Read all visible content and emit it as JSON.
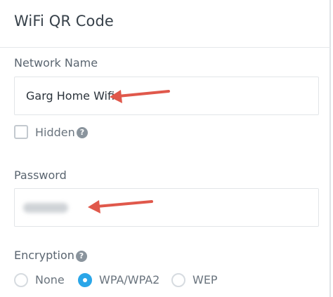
{
  "title": "WiFi QR Code",
  "network": {
    "label": "Network Name",
    "value": "Garg Home Wifi",
    "hidden_label": "Hidden",
    "hidden_checked": false,
    "help_glyph": "?"
  },
  "password": {
    "label": "Password",
    "value_obscured": true
  },
  "encryption": {
    "label": "Encryption",
    "help_glyph": "?",
    "options": [
      "None",
      "WPA/WPA2",
      "WEP"
    ],
    "selected": "WPA/WPA2"
  },
  "colors": {
    "accent": "#2aa6e8",
    "annotation_arrow": "#e0584b"
  }
}
